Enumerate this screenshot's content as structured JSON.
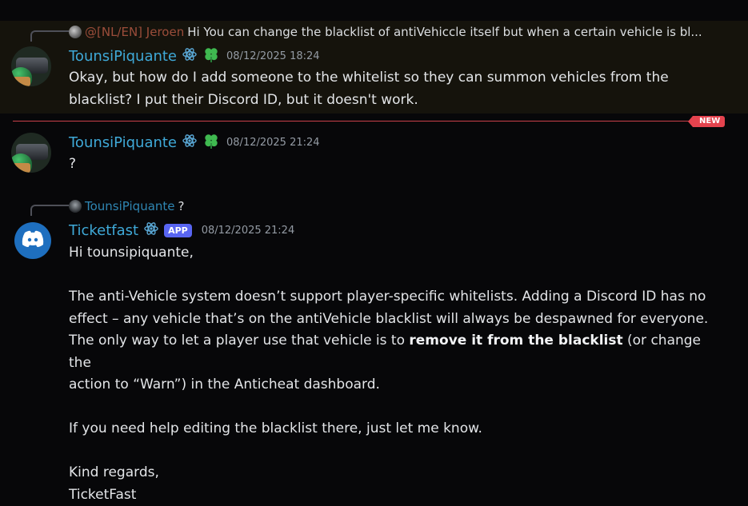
{
  "messages": [
    {
      "reply": {
        "author": "@[NL/EN] Jeroen",
        "text": "Hi  You can change the blacklist of antiVehiccle itself but when a certain vehicle is bl..."
      },
      "author": "TounsiPiquante",
      "timestamp": "08/12/2025 18:24",
      "lines": [
        "Okay, but how do I add someone to the whitelist so they can summon vehicles from the",
        "blacklist? I put their Discord ID, but it doesn't work."
      ]
    },
    {
      "author": "TounsiPiquante",
      "timestamp": "08/12/2025 21:24",
      "lines": [
        "?"
      ]
    },
    {
      "reply": {
        "author": "TounsiPiquante",
        "text": "?"
      },
      "author": "Ticketfast",
      "app_tag": "APP",
      "timestamp": "08/12/2025 21:24",
      "greeting": "Hi tounsipiquante,",
      "para1_lines": [
        "The anti-Vehicle system doesn’t support player-specific whitelists. Adding a Discord ID has no",
        "effect – any vehicle that’s on the antiVehicle blacklist will always be despawned for everyone."
      ],
      "para1_line3_pre": "The only way to let a player use that vehicle is to ",
      "para1_line3_bold": "remove it from the blacklist",
      "para1_line3_post": " (or change the",
      "para1_line4": "action to “Warn”) in the Anticheat dashboard.",
      "para2": "If you need help editing the blacklist there, just let me know.",
      "closing1": "Kind regards,",
      "closing2": "TicketFast"
    }
  ],
  "new_divider_label": "NEW",
  "icons": {
    "badge1": "atom-badge-icon",
    "badge2": "clover-badge-icon",
    "bot_avatar": "discord-logo-icon"
  },
  "colors": {
    "username": "#3fa9d8",
    "divider": "#e4434e",
    "app_tag": "#5865f2"
  }
}
